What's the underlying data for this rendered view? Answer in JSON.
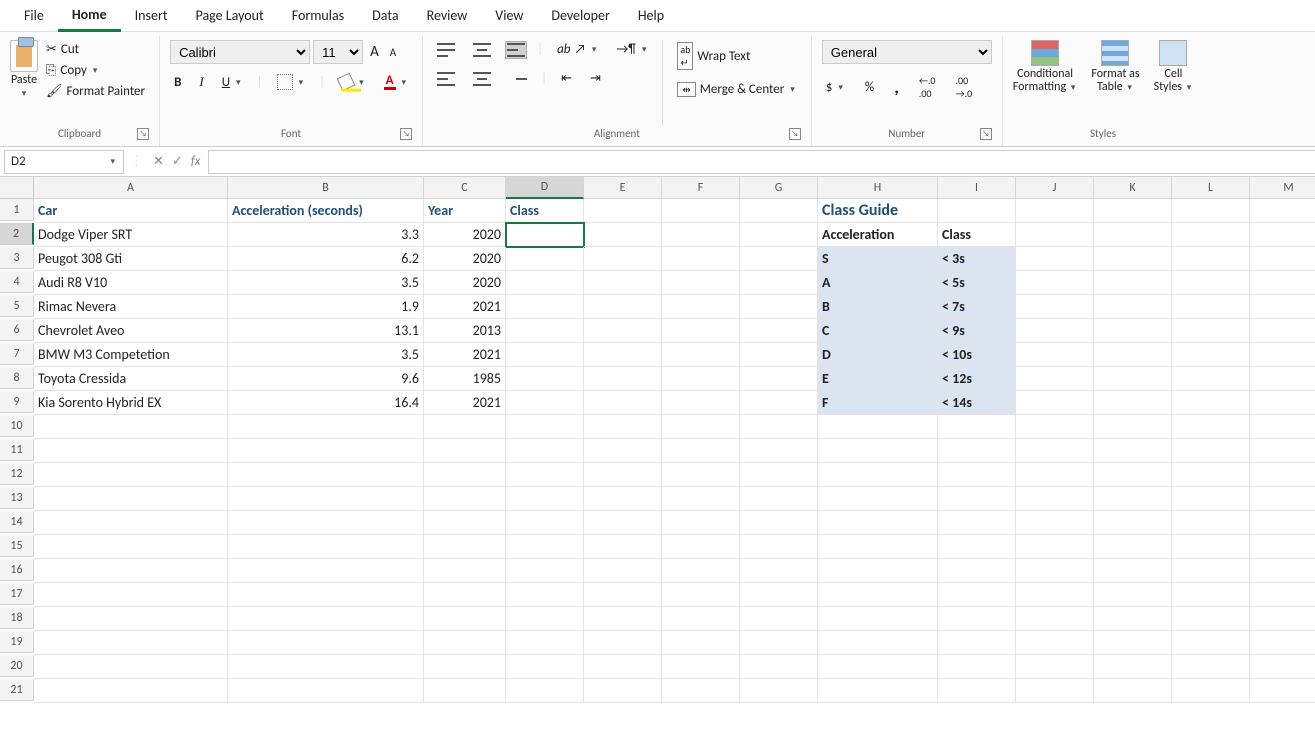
{
  "menu": [
    "File",
    "Home",
    "Insert",
    "Page Layout",
    "Formulas",
    "Data",
    "Review",
    "View",
    "Developer",
    "Help"
  ],
  "menu_active": "Home",
  "clipboard": {
    "paste": "Paste",
    "cut": "Cut",
    "copy": "Copy",
    "fp": "Format Painter",
    "title": "Clipboard"
  },
  "font": {
    "name": "Calibri",
    "size": "11",
    "bold": "B",
    "italic": "I",
    "underline": "U",
    "title": "Font",
    "incA": "A",
    "decA": "A",
    "fcolor": "A"
  },
  "alignment": {
    "wrap": "Wrap Text",
    "merge": "Merge & Center",
    "title": "Alignment",
    "ab": "ab"
  },
  "number": {
    "format": "General",
    "title": "Number",
    "dollar": "$",
    "pct": "%",
    "comma": ",",
    "dec_inc": ".00←",
    "dec_dec": ".00→"
  },
  "styles": {
    "cond": "Conditional\nFormatting",
    "fat": "Format as\nTable",
    "cell": "Cell\nStyles",
    "title": "Styles"
  },
  "namebox": "D2",
  "fx": "fx",
  "cols": [
    "A",
    "B",
    "C",
    "D",
    "E",
    "F",
    "G",
    "H",
    "I",
    "J",
    "K",
    "L",
    "M"
  ],
  "rows": 21,
  "selected": {
    "col": "D",
    "row": 2
  },
  "headers": {
    "A": "Car",
    "B": "Acceleration (seconds)",
    "C": "Year",
    "D": "Class"
  },
  "cars": [
    {
      "name": "Dodge Viper SRT",
      "acc": "3.3",
      "year": "2020"
    },
    {
      "name": "Peugot 308 Gti",
      "acc": "6.2",
      "year": "2020"
    },
    {
      "name": "Audi R8 V10",
      "acc": "3.5",
      "year": "2020"
    },
    {
      "name": "Rimac Nevera",
      "acc": "1.9",
      "year": "2021"
    },
    {
      "name": "Chevrolet Aveo",
      "acc": "13.1",
      "year": "2013"
    },
    {
      "name": "BMW M3 Competetion",
      "acc": "3.5",
      "year": "2021"
    },
    {
      "name": "Toyota Cressida",
      "acc": "9.6",
      "year": "1985"
    },
    {
      "name": "Kia Sorento Hybrid EX",
      "acc": "16.4",
      "year": "2021"
    }
  ],
  "guide": {
    "title": "Class Guide",
    "h1": "Acceleration",
    "h2": "Class",
    "rows": [
      {
        "cls": "S",
        "val": "< 3s"
      },
      {
        "cls": "A",
        "val": "< 5s"
      },
      {
        "cls": "B",
        "val": "< 7s"
      },
      {
        "cls": "C",
        "val": "< 9s"
      },
      {
        "cls": "D",
        "val": "< 10s"
      },
      {
        "cls": "E",
        "val": "< 12s"
      },
      {
        "cls": "F",
        "val": "< 14s"
      }
    ]
  }
}
